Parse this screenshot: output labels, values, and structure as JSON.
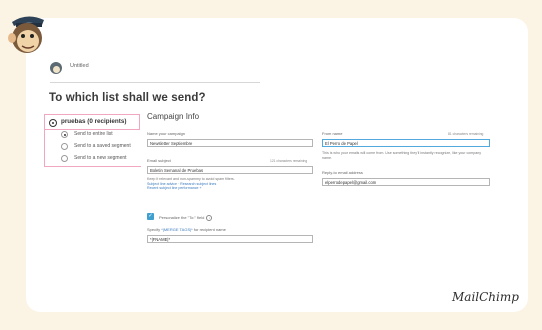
{
  "window": {
    "title": "Untitled"
  },
  "heading": "To which list shall we send?",
  "list": {
    "name": "pruebas (0 recipients)",
    "options": [
      {
        "label": "Send to entire list",
        "selected": true
      },
      {
        "label": "Send to a saved segment",
        "selected": false
      },
      {
        "label": "Send to a new segment",
        "selected": false
      }
    ]
  },
  "campaign": {
    "section_title": "Campaign Info",
    "name_label": "Name your campaign",
    "name_value": "Newsletter Septiembre",
    "subject_label": "Email subject",
    "subject_count": "121 characters remaining",
    "subject_value": "Boletin Semanal de Pruebas",
    "subject_hint": "Keep it relevant and non-spammy to avoid spam filters.",
    "subject_links": "Subject line advice · Research subject lines",
    "subject_perf": "Recent subject line performance +",
    "from_label": "From name",
    "from_count": "81 characters remaining",
    "from_value": "El Perro de Papel",
    "from_hint": "This is who your emails will come from. Use something they'll instantly recognize, like your company name.",
    "reply_label": "Reply-to email address",
    "reply_value": "elperrodepapel@gmail.com",
    "personalize_label": "Personalize the \"To:\" field",
    "personalize_checked": true,
    "merge_label_prefix": "Specify ",
    "merge_label_link": "*|MERGE TAGS|*",
    "merge_label_suffix": " for recipient name",
    "merge_value": "*|FNAME|*"
  },
  "brand": "MailChimp",
  "icons": {
    "mascot": "chimp-mascot-icon",
    "avatar": "user-avatar-icon",
    "info": "info-icon",
    "check": "checkmark-icon"
  },
  "colors": {
    "background": "#fbf3e3",
    "highlight": "#f2a7c1",
    "accent": "#3f9fcf",
    "link": "#3b7bbd"
  }
}
